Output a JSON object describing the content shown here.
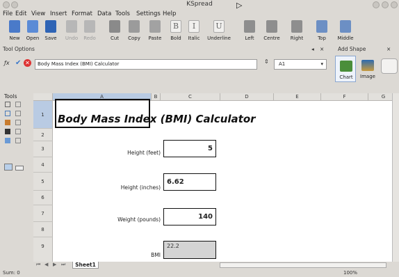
{
  "window": {
    "title": "KSpread"
  },
  "menu": [
    "File",
    "Edit",
    "View",
    "Insert",
    "Format",
    "Data",
    "Tools",
    "Settings",
    "Help"
  ],
  "toolbar": {
    "buttons": [
      {
        "label": "New",
        "icon": "new-document-icon",
        "enabled": true
      },
      {
        "label": "Open",
        "icon": "open-folder-icon",
        "enabled": true
      },
      {
        "label": "Save",
        "icon": "save-icon",
        "enabled": true
      },
      {
        "label": "Undo",
        "icon": "undo-icon",
        "enabled": false
      },
      {
        "label": "Redo",
        "icon": "redo-icon",
        "enabled": false
      },
      {
        "label": "Cut",
        "icon": "scissors-icon",
        "enabled": true
      },
      {
        "label": "Copy",
        "icon": "copy-icon",
        "enabled": true
      },
      {
        "label": "Paste",
        "icon": "paste-icon",
        "enabled": true
      },
      {
        "label": "Bold",
        "icon": "bold-icon",
        "glyph": "B",
        "enabled": true
      },
      {
        "label": "Italic",
        "icon": "italic-icon",
        "glyph": "I",
        "enabled": true
      },
      {
        "label": "Underline",
        "icon": "underline-icon",
        "glyph": "U",
        "enabled": true
      },
      {
        "label": "Left",
        "icon": "align-left-icon",
        "enabled": true
      },
      {
        "label": "Centre",
        "icon": "align-centre-icon",
        "enabled": true
      },
      {
        "label": "Right",
        "icon": "align-right-icon",
        "enabled": true
      },
      {
        "label": "Top",
        "icon": "align-top-icon",
        "enabled": true
      },
      {
        "label": "Middle",
        "icon": "align-middle-icon",
        "enabled": true
      }
    ]
  },
  "docks": {
    "tool_options": "Tool Options",
    "add_shape": "Add Shape",
    "tools": "Tools"
  },
  "formula_bar": {
    "value": "Body Mass Index (BMI) Calculator",
    "cell_ref": "A1",
    "func_glyph": "ƒx"
  },
  "shapes": [
    {
      "label": "Chart",
      "icon": "chart-shape-icon"
    },
    {
      "label": "Image",
      "icon": "image-shape-icon"
    }
  ],
  "spreadsheet": {
    "columns": [
      "A",
      "B",
      "C",
      "D",
      "E",
      "F",
      "G"
    ],
    "rows": [
      "1",
      "2",
      "3",
      "4",
      "5",
      "6",
      "7",
      "8",
      "9"
    ],
    "title": "Body Mass Index (BMI) Calculator",
    "fields": [
      {
        "label": "Height (feet)",
        "value": "5"
      },
      {
        "label": "Height (inches)",
        "value": "6.62"
      },
      {
        "label": "Weight (pounds)",
        "value": "140"
      },
      {
        "label": "BMI",
        "value": "22.2"
      }
    ]
  },
  "sheet_tab": "Sheet1",
  "status": {
    "left": "Sum: 0",
    "zoom": "100%"
  },
  "colors": {
    "accent": "#b9cbe3",
    "window_bg": "#dcd9d4",
    "bmi_cell_bg": "#d4d4d4"
  }
}
